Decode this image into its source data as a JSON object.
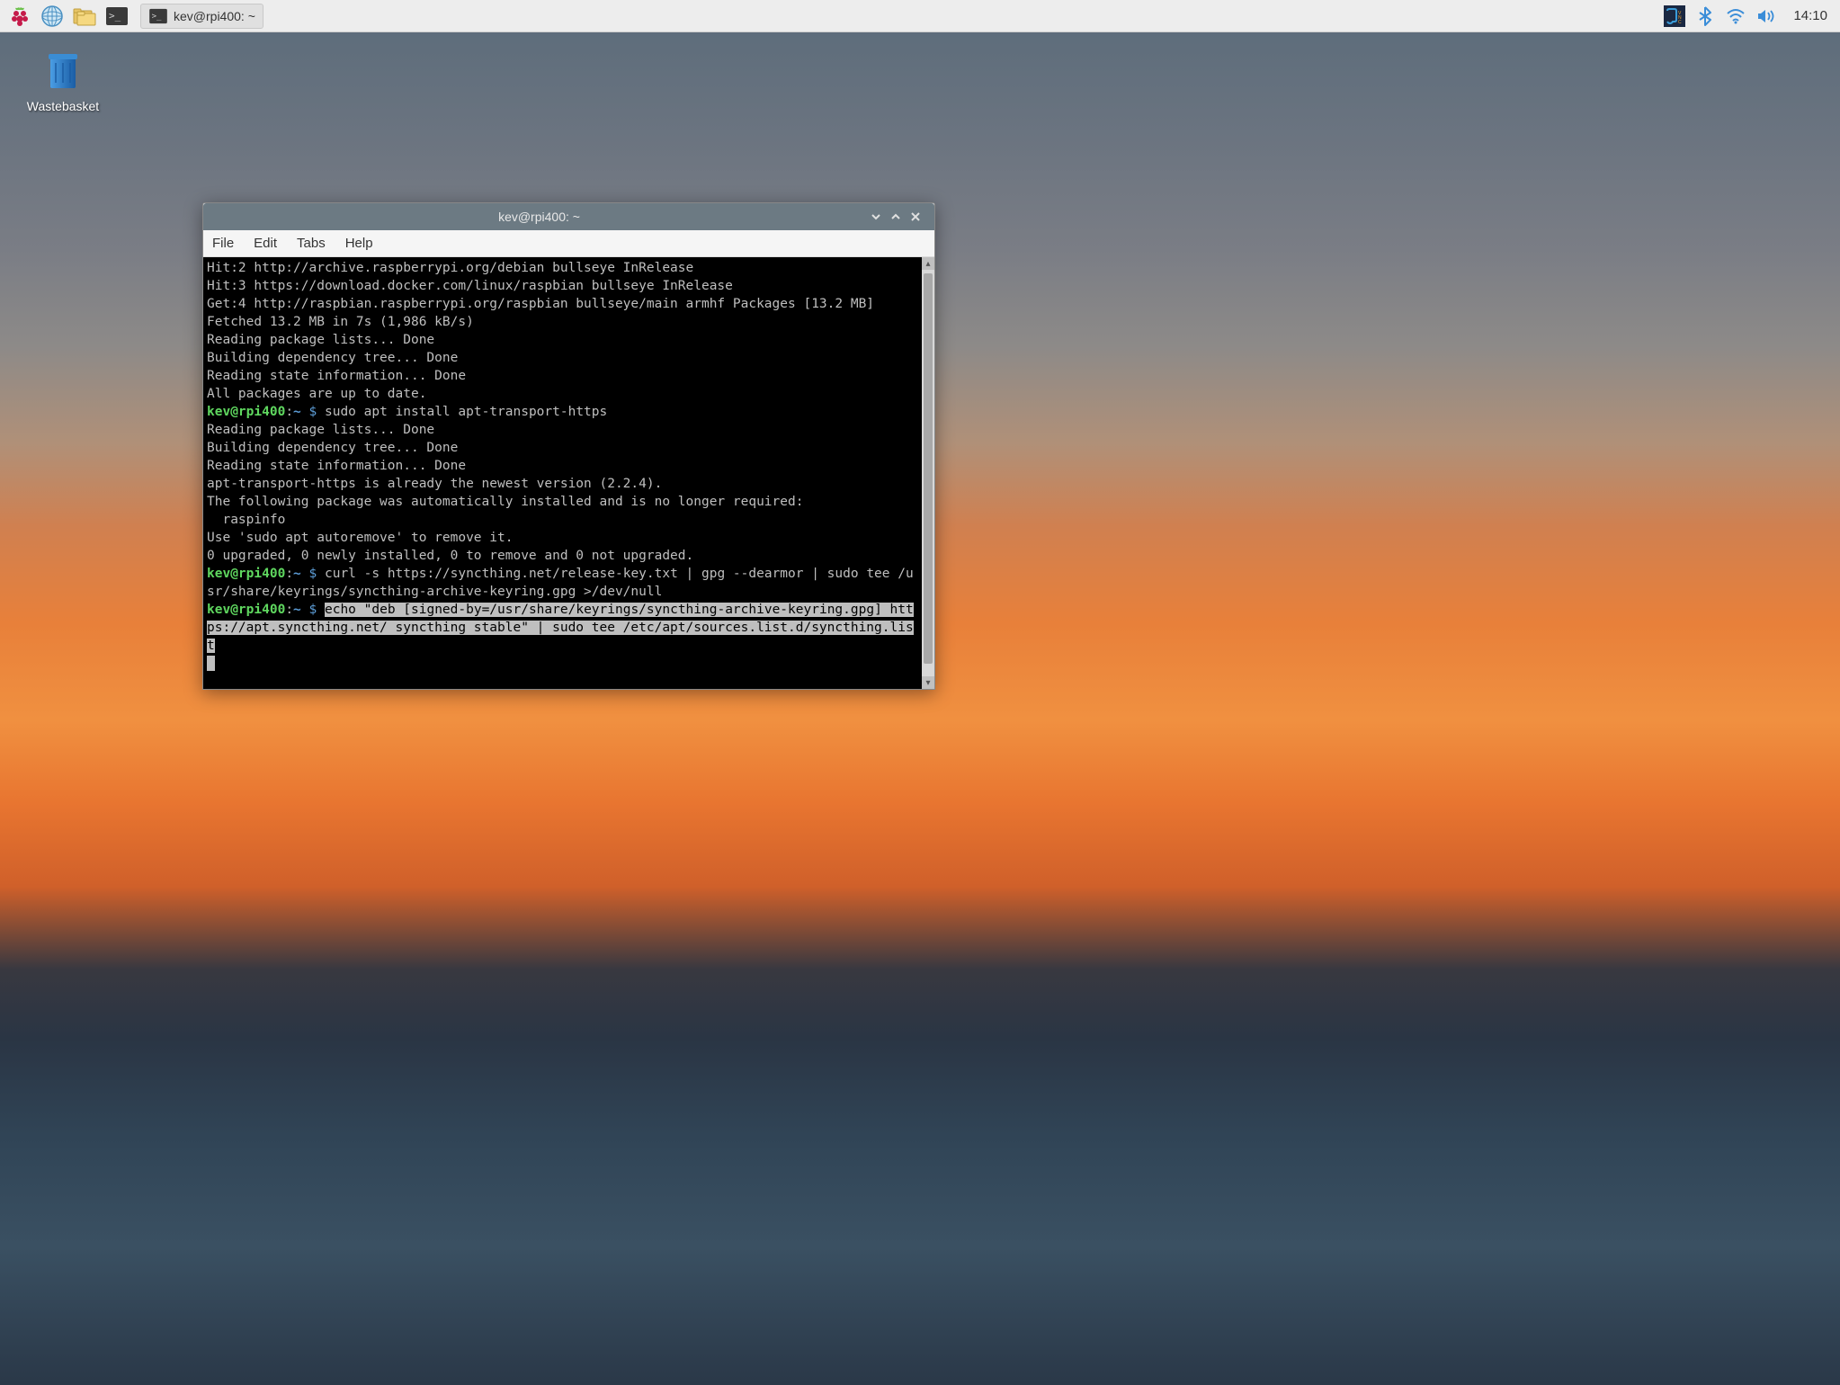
{
  "taskbar": {
    "task_button_label": "kev@rpi400: ~",
    "clock": "14:10"
  },
  "desktop": {
    "wastebasket_label": "Wastebasket"
  },
  "terminal": {
    "title": "kev@rpi400: ~",
    "menu": {
      "file": "File",
      "edit": "Edit",
      "tabs": "Tabs",
      "help": "Help"
    },
    "prompt": {
      "user": "kev@rpi400",
      "path": "~",
      "sep": ":",
      "dollar": "$"
    },
    "lines": {
      "l01": "Hit:2 http://archive.raspberrypi.org/debian bullseye InRelease",
      "l02": "Hit:3 https://download.docker.com/linux/raspbian bullseye InRelease",
      "l03": "Get:4 http://raspbian.raspberrypi.org/raspbian bullseye/main armhf Packages [13.2 MB]",
      "l04": "Fetched 13.2 MB in 7s (1,986 kB/s)",
      "l05": "Reading package lists... Done",
      "l06": "Building dependency tree... Done",
      "l07": "Reading state information... Done",
      "l08": "All packages are up to date.",
      "cmd1": " sudo apt install apt-transport-https",
      "l09": "Reading package lists... Done",
      "l10": "Building dependency tree... Done",
      "l11": "Reading state information... Done",
      "l12": "apt-transport-https is already the newest version (2.2.4).",
      "l13": "The following package was automatically installed and is no longer required:",
      "l14": "  raspinfo",
      "l15": "Use 'sudo apt autoremove' to remove it.",
      "l16": "0 upgraded, 0 newly installed, 0 to remove and 0 not upgraded.",
      "cmd2": " curl -s https://syncthing.net/release-key.txt | gpg --dearmor | sudo tee /usr/share/keyrings/syncthing-archive-keyring.gpg >/dev/null",
      "cmd3_sel": "echo \"deb [signed-by=/usr/share/keyrings/syncthing-archive-keyring.gpg] https://apt.syncthing.net/ syncthing stable\" | sudo tee /etc/apt/sources.list.d/syncthing.list"
    }
  }
}
